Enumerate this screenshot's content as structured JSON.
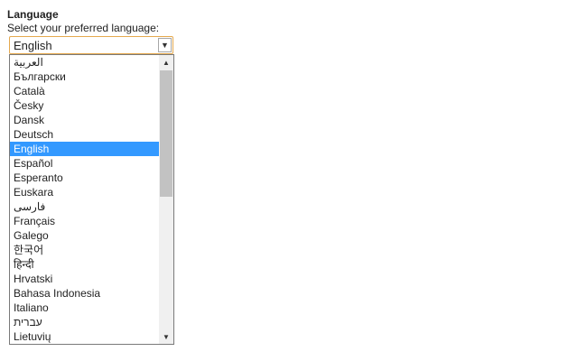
{
  "header": {
    "title": "Language",
    "subtitle": "Select your preferred language:"
  },
  "select": {
    "value": "English",
    "arrow_icon": "chevron-down-icon"
  },
  "options": [
    "العربية",
    "Български",
    "Català",
    "Česky",
    "Dansk",
    "Deutsch",
    "English",
    "Español",
    "Esperanto",
    "Euskara",
    "فارسی",
    "Français",
    "Galego",
    "한국어",
    "हिन्दी",
    "Hrvatski",
    "Bahasa Indonesia",
    "Italiano",
    "עברית",
    "Lietuvių"
  ],
  "selected_index": 6,
  "colors": {
    "highlight": "#3399ff",
    "select_border": "#e5a94e"
  }
}
